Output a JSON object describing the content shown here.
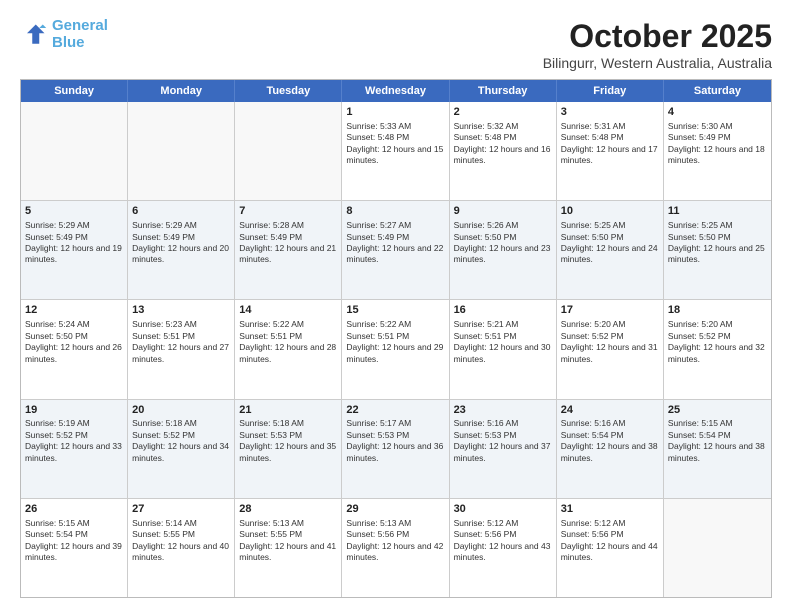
{
  "header": {
    "logo_line1": "General",
    "logo_line2": "Blue",
    "title": "October 2025",
    "subtitle": "Bilingurr, Western Australia, Australia"
  },
  "calendar": {
    "days_of_week": [
      "Sunday",
      "Monday",
      "Tuesday",
      "Wednesday",
      "Thursday",
      "Friday",
      "Saturday"
    ],
    "weeks": [
      [
        {
          "day": "",
          "empty": true
        },
        {
          "day": "",
          "empty": true
        },
        {
          "day": "",
          "empty": true
        },
        {
          "day": "1",
          "sunrise": "5:33 AM",
          "sunset": "5:48 PM",
          "daylight": "12 hours and 15 minutes."
        },
        {
          "day": "2",
          "sunrise": "5:32 AM",
          "sunset": "5:48 PM",
          "daylight": "12 hours and 16 minutes."
        },
        {
          "day": "3",
          "sunrise": "5:31 AM",
          "sunset": "5:48 PM",
          "daylight": "12 hours and 17 minutes."
        },
        {
          "day": "4",
          "sunrise": "5:30 AM",
          "sunset": "5:49 PM",
          "daylight": "12 hours and 18 minutes."
        }
      ],
      [
        {
          "day": "5",
          "sunrise": "5:29 AM",
          "sunset": "5:49 PM",
          "daylight": "12 hours and 19 minutes."
        },
        {
          "day": "6",
          "sunrise": "5:29 AM",
          "sunset": "5:49 PM",
          "daylight": "12 hours and 20 minutes."
        },
        {
          "day": "7",
          "sunrise": "5:28 AM",
          "sunset": "5:49 PM",
          "daylight": "12 hours and 21 minutes."
        },
        {
          "day": "8",
          "sunrise": "5:27 AM",
          "sunset": "5:49 PM",
          "daylight": "12 hours and 22 minutes."
        },
        {
          "day": "9",
          "sunrise": "5:26 AM",
          "sunset": "5:50 PM",
          "daylight": "12 hours and 23 minutes."
        },
        {
          "day": "10",
          "sunrise": "5:25 AM",
          "sunset": "5:50 PM",
          "daylight": "12 hours and 24 minutes."
        },
        {
          "day": "11",
          "sunrise": "5:25 AM",
          "sunset": "5:50 PM",
          "daylight": "12 hours and 25 minutes."
        }
      ],
      [
        {
          "day": "12",
          "sunrise": "5:24 AM",
          "sunset": "5:50 PM",
          "daylight": "12 hours and 26 minutes."
        },
        {
          "day": "13",
          "sunrise": "5:23 AM",
          "sunset": "5:51 PM",
          "daylight": "12 hours and 27 minutes."
        },
        {
          "day": "14",
          "sunrise": "5:22 AM",
          "sunset": "5:51 PM",
          "daylight": "12 hours and 28 minutes."
        },
        {
          "day": "15",
          "sunrise": "5:22 AM",
          "sunset": "5:51 PM",
          "daylight": "12 hours and 29 minutes."
        },
        {
          "day": "16",
          "sunrise": "5:21 AM",
          "sunset": "5:51 PM",
          "daylight": "12 hours and 30 minutes."
        },
        {
          "day": "17",
          "sunrise": "5:20 AM",
          "sunset": "5:52 PM",
          "daylight": "12 hours and 31 minutes."
        },
        {
          "day": "18",
          "sunrise": "5:20 AM",
          "sunset": "5:52 PM",
          "daylight": "12 hours and 32 minutes."
        }
      ],
      [
        {
          "day": "19",
          "sunrise": "5:19 AM",
          "sunset": "5:52 PM",
          "daylight": "12 hours and 33 minutes."
        },
        {
          "day": "20",
          "sunrise": "5:18 AM",
          "sunset": "5:52 PM",
          "daylight": "12 hours and 34 minutes."
        },
        {
          "day": "21",
          "sunrise": "5:18 AM",
          "sunset": "5:53 PM",
          "daylight": "12 hours and 35 minutes."
        },
        {
          "day": "22",
          "sunrise": "5:17 AM",
          "sunset": "5:53 PM",
          "daylight": "12 hours and 36 minutes."
        },
        {
          "day": "23",
          "sunrise": "5:16 AM",
          "sunset": "5:53 PM",
          "daylight": "12 hours and 37 minutes."
        },
        {
          "day": "24",
          "sunrise": "5:16 AM",
          "sunset": "5:54 PM",
          "daylight": "12 hours and 38 minutes."
        },
        {
          "day": "25",
          "sunrise": "5:15 AM",
          "sunset": "5:54 PM",
          "daylight": "12 hours and 38 minutes."
        }
      ],
      [
        {
          "day": "26",
          "sunrise": "5:15 AM",
          "sunset": "5:54 PM",
          "daylight": "12 hours and 39 minutes."
        },
        {
          "day": "27",
          "sunrise": "5:14 AM",
          "sunset": "5:55 PM",
          "daylight": "12 hours and 40 minutes."
        },
        {
          "day": "28",
          "sunrise": "5:13 AM",
          "sunset": "5:55 PM",
          "daylight": "12 hours and 41 minutes."
        },
        {
          "day": "29",
          "sunrise": "5:13 AM",
          "sunset": "5:56 PM",
          "daylight": "12 hours and 42 minutes."
        },
        {
          "day": "30",
          "sunrise": "5:12 AM",
          "sunset": "5:56 PM",
          "daylight": "12 hours and 43 minutes."
        },
        {
          "day": "31",
          "sunrise": "5:12 AM",
          "sunset": "5:56 PM",
          "daylight": "12 hours and 44 minutes."
        },
        {
          "day": "",
          "empty": true
        }
      ]
    ]
  }
}
